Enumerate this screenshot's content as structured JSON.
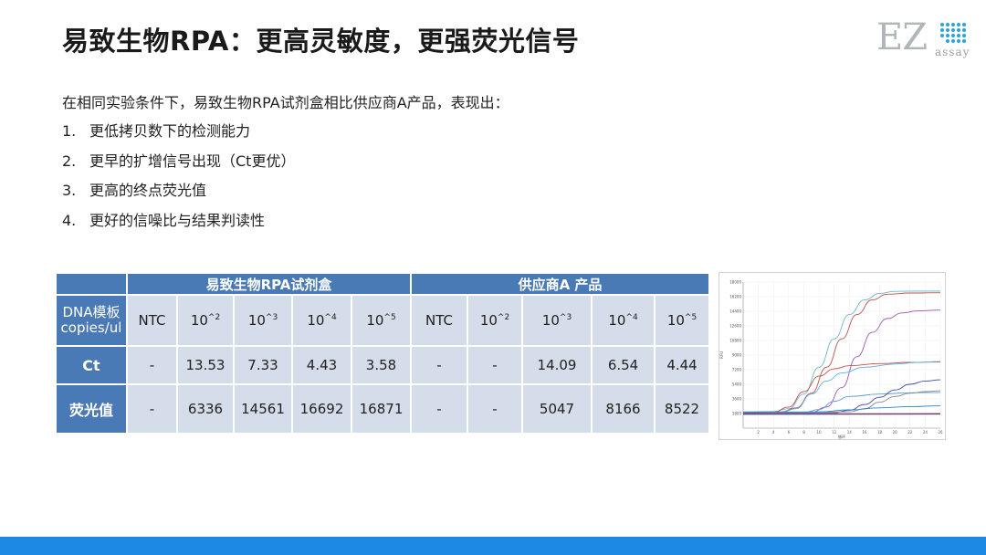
{
  "slide": {
    "title": "易致生物RPA：更高灵敏度，更强荧光信号",
    "intro": "在相同实验条件下，易致生物RPA试剂盒相比供应商A产品，表现出：",
    "points": [
      {
        "num": "1.",
        "text": "更低拷贝数下的检测能力"
      },
      {
        "num": "2.",
        "text": "更早的扩增信号出现（Ct更优）"
      },
      {
        "num": "3.",
        "text": "更高的终点荧光值"
      },
      {
        "num": "4.",
        "text": "更好的信噪比与结果判读性"
      }
    ]
  },
  "logo": {
    "main": "EZ",
    "sub": "assay"
  },
  "table": {
    "group1": "易致生物RPA试剂盒",
    "group2": "供应商A 产品",
    "row_dna_label_1": "DNA模板",
    "row_dna_label_2": "copies/ul",
    "columns": [
      "NTC",
      "10^2",
      "10^3",
      "10^4",
      "10^5",
      "NTC",
      "10^2",
      "10^3",
      "10^4",
      "10^5"
    ],
    "ct_label": "Ct",
    "ct": [
      "-",
      "13.53",
      "7.33",
      "4.43",
      "3.58",
      "-",
      "-",
      "14.09",
      "6.54",
      "4.44"
    ],
    "fl_label": "荧光值",
    "fl": [
      "-",
      "6336",
      "14561",
      "16692",
      "16871",
      "-",
      "-",
      "5047",
      "8166",
      "8522"
    ]
  },
  "chart_data": {
    "type": "line",
    "xlabel": "循环",
    "ylabel": "RFU",
    "x_ticks": [
      "2",
      "4",
      "6",
      "8",
      "10",
      "12",
      "14",
      "16",
      "18",
      "20",
      "22",
      "24",
      "26"
    ],
    "y_ticks": [
      "1800",
      "3600",
      "5400",
      "7200",
      "9000",
      "10800",
      "12600",
      "14400",
      "16200",
      "18000"
    ],
    "xlim": [
      0,
      26
    ],
    "ylim": [
      0,
      18000
    ],
    "grid": true,
    "series": [
      {
        "color": "#6fb7c9",
        "values": [
          [
            0,
            2000
          ],
          [
            4,
            2050
          ],
          [
            6,
            2400
          ],
          [
            8,
            4200
          ],
          [
            10,
            7500
          ],
          [
            12,
            11000
          ],
          [
            14,
            14000
          ],
          [
            16,
            15800
          ],
          [
            18,
            16600
          ],
          [
            20,
            16850
          ],
          [
            22,
            16880
          ],
          [
            26,
            16890
          ]
        ]
      },
      {
        "color": "#c0504d",
        "values": [
          [
            0,
            1950
          ],
          [
            5,
            2000
          ],
          [
            7,
            2500
          ],
          [
            9,
            4300
          ],
          [
            11,
            7500
          ],
          [
            13,
            11000
          ],
          [
            15,
            14000
          ],
          [
            17,
            15800
          ],
          [
            19,
            16500
          ],
          [
            22,
            16650
          ],
          [
            26,
            16680
          ]
        ]
      },
      {
        "color": "#9b59b6",
        "values": [
          [
            0,
            1900
          ],
          [
            9,
            1950
          ],
          [
            11,
            2600
          ],
          [
            13,
            5000
          ],
          [
            15,
            8800
          ],
          [
            17,
            11800
          ],
          [
            19,
            13500
          ],
          [
            21,
            14200
          ],
          [
            23,
            14450
          ],
          [
            26,
            14550
          ]
        ]
      },
      {
        "color": "#c0504d",
        "values": [
          [
            0,
            1900
          ],
          [
            4,
            1950
          ],
          [
            6,
            2600
          ],
          [
            8,
            4500
          ],
          [
            10,
            6400
          ],
          [
            12,
            7300
          ],
          [
            14,
            7700
          ],
          [
            18,
            7950
          ],
          [
            22,
            8100
          ],
          [
            26,
            8150
          ]
        ]
      },
      {
        "color": "#5dade2",
        "values": [
          [
            0,
            1900
          ],
          [
            5,
            1950
          ],
          [
            7,
            2400
          ],
          [
            9,
            4200
          ],
          [
            11,
            5800
          ],
          [
            13,
            6800
          ],
          [
            16,
            7500
          ],
          [
            20,
            7900
          ],
          [
            23,
            8100
          ],
          [
            26,
            8200
          ]
        ]
      },
      {
        "color": "#5b9bd5",
        "values": [
          [
            0,
            1850
          ],
          [
            8,
            1900
          ],
          [
            10,
            2300
          ],
          [
            12,
            3300
          ],
          [
            14,
            3900
          ],
          [
            18,
            4200
          ],
          [
            22,
            4350
          ],
          [
            26,
            4400
          ]
        ]
      },
      {
        "color": "#3949ab",
        "values": [
          [
            0,
            1850
          ],
          [
            12,
            1900
          ],
          [
            14,
            2200
          ],
          [
            16,
            2900
          ],
          [
            18,
            3800
          ],
          [
            20,
            4700
          ],
          [
            22,
            5400
          ],
          [
            24,
            5800
          ],
          [
            26,
            5950
          ]
        ]
      },
      {
        "color": "#888888",
        "values": [
          [
            0,
            1900
          ],
          [
            14,
            2000
          ],
          [
            16,
            2400
          ],
          [
            18,
            3200
          ],
          [
            20,
            3900
          ],
          [
            22,
            4300
          ],
          [
            24,
            4500
          ],
          [
            26,
            4600
          ]
        ]
      },
      {
        "color": "#2e86c1",
        "values": [
          [
            0,
            1950
          ],
          [
            10,
            2000
          ],
          [
            14,
            2250
          ],
          [
            18,
            2500
          ],
          [
            22,
            2650
          ],
          [
            26,
            2750
          ]
        ]
      },
      {
        "color": "#e74c3c",
        "values": [
          [
            0,
            1750
          ],
          [
            26,
            1800
          ]
        ]
      },
      {
        "color": "#1f3a93",
        "values": [
          [
            0,
            1700
          ],
          [
            26,
            1720
          ]
        ]
      }
    ]
  }
}
